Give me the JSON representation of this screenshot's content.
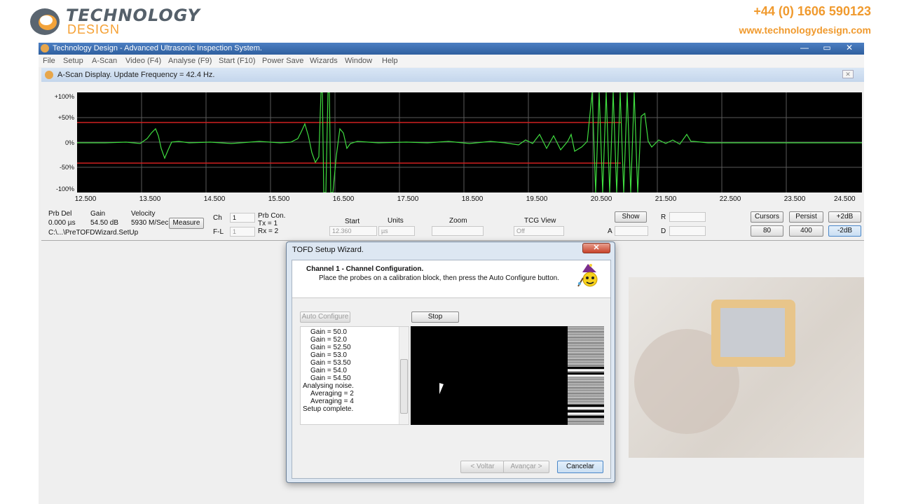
{
  "header": {
    "logo_line1": "TECHNOLOGY",
    "logo_line2": "DESIGN",
    "phone": "+44 (0) 1606 590123",
    "website": "www.technologydesign.com",
    "brand_color": "#f09a2e"
  },
  "app": {
    "title": "Technology Design - Advanced Ultrasonic Inspection System.",
    "window_buttons": [
      "—",
      "▭",
      "✕"
    ],
    "menu": [
      "File",
      "Setup",
      "A-Scan",
      "Video (F4)",
      "Analyse (F9)",
      "Start (F10)",
      "Power Save",
      "Wizards",
      "Window",
      "Help"
    ]
  },
  "ascan": {
    "title": "A-Scan Display. Update Frequency = 42.4 Hz.",
    "y_labels": [
      "+100%",
      "+50%",
      "0%",
      "-50%",
      "-100%"
    ],
    "x_labels": [
      "12.500",
      "13.500",
      "14.500",
      "15.500",
      "16.500",
      "17.500",
      "18.500",
      "19.500",
      "20.500",
      "21.500",
      "22.500",
      "23.500",
      "24.500"
    ],
    "trace_color": "#3fdc3f",
    "gate_color": "#d02020"
  },
  "controls": {
    "prb_del_label": "Prb Del",
    "prb_del_value": "0.000 µs",
    "gain_label": "Gain",
    "gain_value": "54.50 dB",
    "velocity_label": "Velocity",
    "velocity_value": "5930 M/Sec",
    "measure": "Measure",
    "path": "C:\\...\\PreTOFDWizard.SetUp",
    "ch_label": "Ch",
    "ch_value": "1",
    "fl_label": "F-L",
    "fl_value": "1",
    "prb_con": "Prb Con.",
    "tx": "Tx = 1",
    "rx": "Rx = 2",
    "start_label": "Start",
    "start_value": "12.360",
    "units_label": "Units",
    "units_value": "µs",
    "zoom_label": "Zoom",
    "tcg_label": "TCG View",
    "tcg_value": "Off",
    "show": "Show",
    "r_label": "R",
    "a_label": "A",
    "d_label": "D",
    "cursors": "Cursors",
    "persist": "Persist",
    "plus2db": "+2dB",
    "b80": "80",
    "b400": "400",
    "minus2db": "-2dB"
  },
  "wizard": {
    "title": "TOFD Setup Wizard.",
    "close": "✕",
    "heading": "Channel 1   -   Channel Configuration.",
    "instruction": "Place the probes on a calibration block, then press the Auto Configure button.",
    "auto_configure": "Auto Configure",
    "stop": "Stop",
    "log": [
      "Gain = 50.0",
      "Gain = 52.0",
      "Gain = 52.50",
      "Gain = 53.0",
      "Gain = 53.50",
      "Gain = 54.0",
      "Gain = 54.50",
      "Analysing noise.",
      "Averaging = 2",
      "Averaging = 4",
      "Setup complete."
    ],
    "back": "< Voltar",
    "next": "Avançar >",
    "cancel": "Cancelar"
  }
}
